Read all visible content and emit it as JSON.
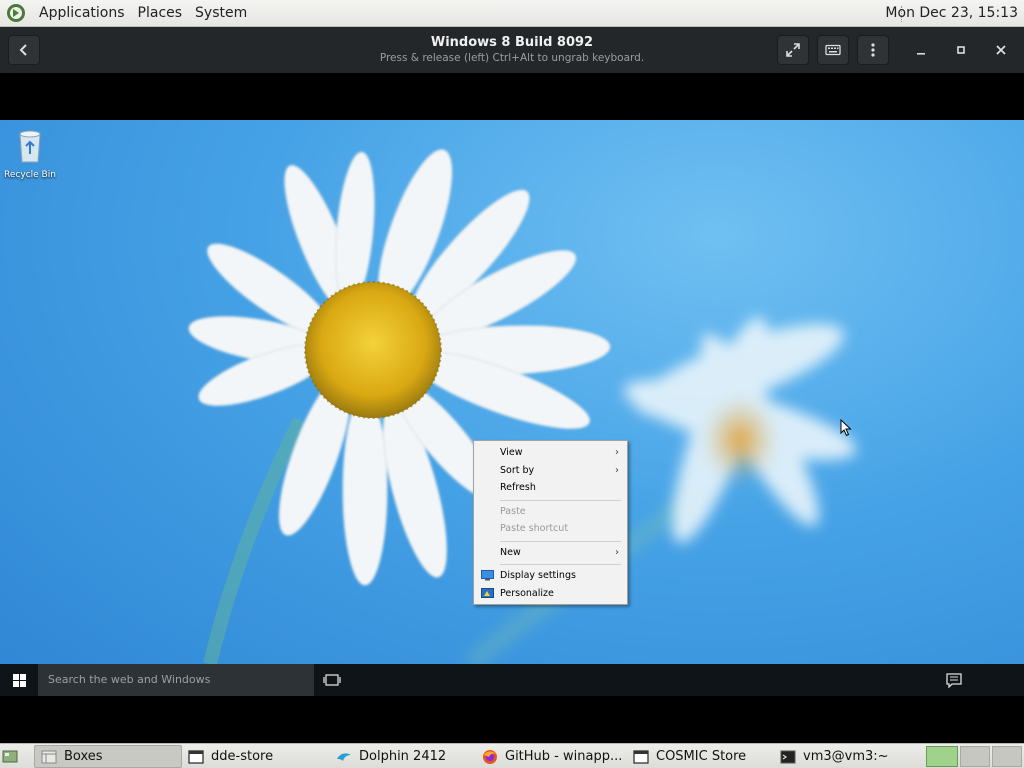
{
  "top_panel": {
    "menus": [
      "Applications",
      "Places",
      "System"
    ],
    "clock": "Mon Dec 23, 15:13"
  },
  "header": {
    "title": "Windows 8 Build 8092",
    "subtitle": "Press & release (left) Ctrl+Alt to ungrab keyboard.",
    "icons": [
      "back-arrow-icon",
      "fullscreen-icon",
      "keyboard-icon",
      "menu-dots-icon",
      "minimize-icon",
      "maximize-icon",
      "close-icon"
    ]
  },
  "desktop": {
    "recycle_bin_label": "Recycle Bin"
  },
  "context_menu": {
    "items": [
      {
        "label": "View",
        "submenu": true,
        "enabled": true
      },
      {
        "label": "Sort by",
        "submenu": true,
        "enabled": true
      },
      {
        "label": "Refresh",
        "enabled": true
      },
      {
        "label": "Paste",
        "enabled": false
      },
      {
        "label": "Paste shortcut",
        "enabled": false
      },
      {
        "label": "New",
        "submenu": true,
        "enabled": true
      },
      {
        "label": "Display settings",
        "enabled": true,
        "icon": "display-settings-icon"
      },
      {
        "label": "Personalize",
        "enabled": true,
        "icon": "personalize-icon"
      }
    ],
    "arrow": "›"
  },
  "win_taskbar": {
    "search_placeholder": "Search the web and Windows"
  },
  "bottom_panel": {
    "tasks": [
      {
        "label": "Boxes",
        "active": true
      },
      {
        "label": "dde-store"
      },
      {
        "label": "Dolphin 2412"
      },
      {
        "label": "GitHub - winapp..."
      },
      {
        "label": "COSMIC Store"
      },
      {
        "label": "vm3@vm3:~"
      }
    ],
    "workspace_active": 1
  },
  "colors": {
    "header_bg": "#232729",
    "sky": "#46a2e6",
    "taskbar_bg": "#0e1418",
    "workspace_active": "#9fd28a"
  }
}
